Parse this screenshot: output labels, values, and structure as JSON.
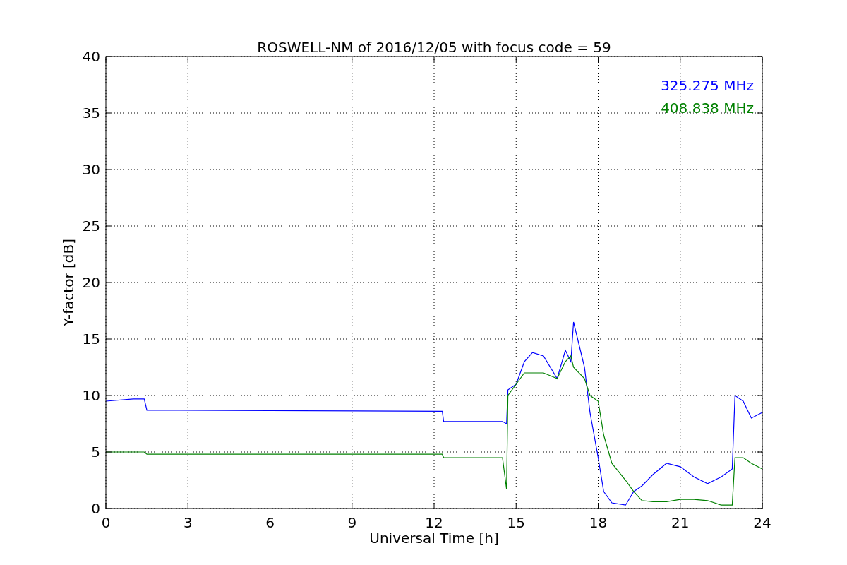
{
  "chart_data": {
    "type": "line",
    "title": "ROSWELL-NM of 2016/12/05 with focus code = 59",
    "xlabel": "Universal Time [h]",
    "ylabel": "Y-factor [dB]",
    "x": [
      0,
      1,
      1.4,
      1.5,
      12.3,
      12.35,
      14.5,
      14.65,
      14.7,
      15,
      15.3,
      15.6,
      16,
      16.5,
      16.8,
      17,
      17.1,
      17.5,
      17.7,
      18,
      18.2,
      18.5,
      19,
      19.3,
      19.6,
      20,
      20.5,
      21,
      21.5,
      22,
      22.5,
      22.9,
      23,
      23.3,
      23.6,
      24
    ],
    "series": [
      {
        "name": "325.275 MHz",
        "color": "#0000ff",
        "values": [
          9.5,
          9.7,
          9.7,
          8.7,
          8.6,
          7.7,
          7.7,
          7.5,
          10.5,
          11,
          13,
          13.8,
          13.5,
          11.5,
          14,
          13,
          16.5,
          12.5,
          8.5,
          4.5,
          1.5,
          0.5,
          0.3,
          1.5,
          2,
          3,
          4,
          3.7,
          2.8,
          2.2,
          2.8,
          3.5,
          10,
          9.5,
          8,
          8.5
        ]
      },
      {
        "name": "408.838 MHz",
        "color": "#008000",
        "values": [
          5,
          5,
          5,
          4.8,
          4.8,
          4.5,
          4.5,
          1.7,
          10,
          11,
          12,
          12,
          12,
          11.5,
          13,
          13.5,
          12.5,
          11.5,
          10,
          9.5,
          6.5,
          4,
          2.5,
          1.5,
          0.7,
          0.6,
          0.6,
          0.8,
          0.8,
          0.7,
          0.3,
          0.3,
          4.5,
          4.5,
          4,
          3.5
        ]
      }
    ],
    "grid": true,
    "xlim": [
      0,
      24
    ],
    "ylim": [
      0,
      40
    ],
    "xticks": [
      0,
      3,
      6,
      9,
      12,
      15,
      18,
      21,
      24
    ],
    "yticks": [
      0,
      5,
      10,
      15,
      20,
      25,
      30,
      35,
      40
    ]
  }
}
